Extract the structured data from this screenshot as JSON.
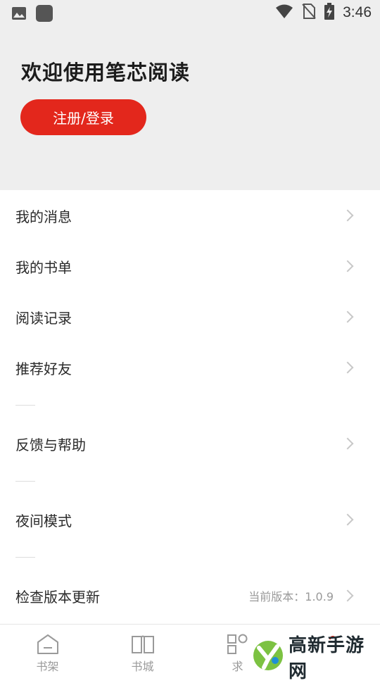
{
  "status_bar": {
    "time": "3:46"
  },
  "header": {
    "title": "欢迎使用笔芯阅读",
    "login_button": "注册/登录"
  },
  "menu": {
    "items": [
      {
        "label": "我的消息"
      },
      {
        "label": "我的书单"
      },
      {
        "label": "阅读记录"
      },
      {
        "label": "推荐好友"
      },
      {
        "label": "反馈与帮助"
      },
      {
        "label": "夜间模式"
      },
      {
        "label": "检查版本更新",
        "value": "当前版本：1.0.9"
      }
    ]
  },
  "tabbar": {
    "tabs": [
      {
        "label": "书架"
      },
      {
        "label": "书城"
      },
      {
        "label": "求"
      }
    ]
  },
  "watermark": {
    "text": "高新手游网"
  },
  "colors": {
    "accent": "#e3271c",
    "header_bg": "#eeeeee",
    "muted_text": "#9a9a9a"
  }
}
